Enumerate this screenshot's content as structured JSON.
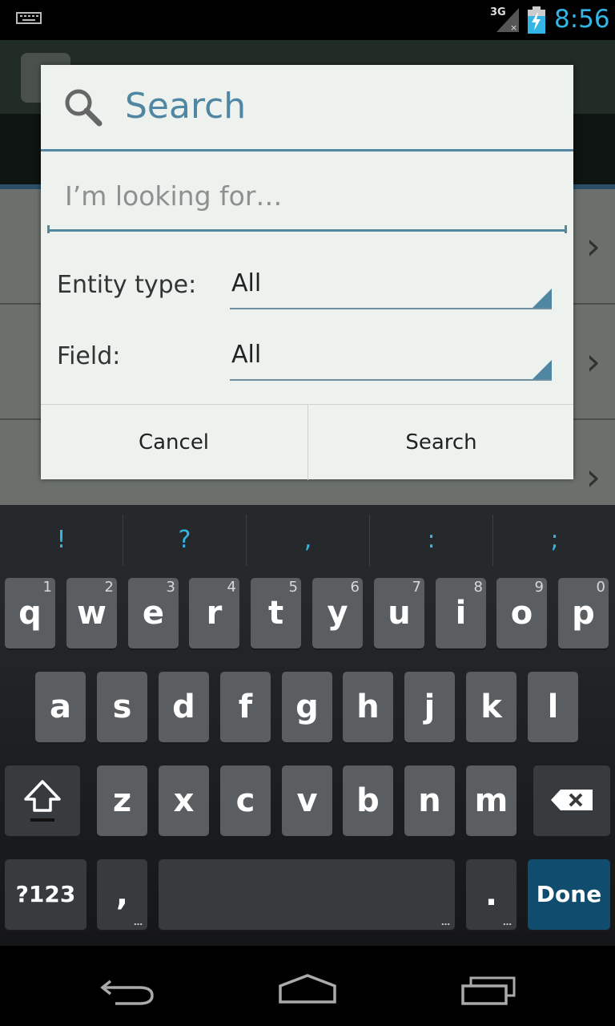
{
  "status_bar": {
    "network": "3G",
    "time": "8:56",
    "icons": [
      "keyboard-icon",
      "signal-icon",
      "battery-charging-icon"
    ]
  },
  "dialog": {
    "title": "Search",
    "icon": "search-icon",
    "query": {
      "value": "",
      "placeholder": "I’m looking for…"
    },
    "entity_type": {
      "label": "Entity type:",
      "selected": "All"
    },
    "field": {
      "label": "Field:",
      "selected": "All"
    },
    "buttons": {
      "cancel": "Cancel",
      "search": "Search"
    }
  },
  "keyboard": {
    "suggestions": [
      "!",
      "?",
      ",",
      ":",
      ";"
    ],
    "row1": [
      {
        "key": "q",
        "num": "1"
      },
      {
        "key": "w",
        "num": "2"
      },
      {
        "key": "e",
        "num": "3"
      },
      {
        "key": "r",
        "num": "4"
      },
      {
        "key": "t",
        "num": "5"
      },
      {
        "key": "y",
        "num": "6"
      },
      {
        "key": "u",
        "num": "7"
      },
      {
        "key": "i",
        "num": "8"
      },
      {
        "key": "o",
        "num": "9"
      },
      {
        "key": "p",
        "num": "0"
      }
    ],
    "row2": [
      "a",
      "s",
      "d",
      "f",
      "g",
      "h",
      "j",
      "k",
      "l"
    ],
    "row3": [
      "z",
      "x",
      "c",
      "v",
      "b",
      "n",
      "m"
    ],
    "symbols_key": "?123",
    "comma_key": ",",
    "period_key": ".",
    "done_key": "Done"
  },
  "nav_bar": {
    "icons": [
      "back-icon",
      "home-icon",
      "recents-icon"
    ]
  },
  "colors": {
    "accent": "#33b5e5",
    "dialog_accent": "#4f86a1",
    "done_key": "#0f4c6d"
  }
}
